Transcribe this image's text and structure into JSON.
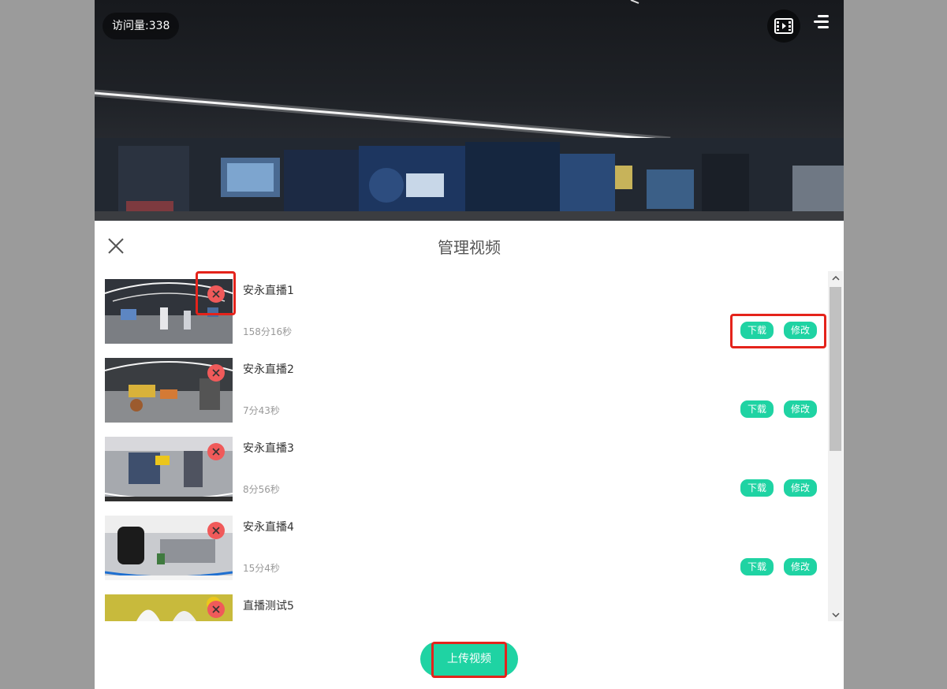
{
  "panorama": {
    "visit_count_text": "访问量:338",
    "icons": {
      "video": "film-icon",
      "menu": "menu-icon"
    }
  },
  "panel": {
    "title": "管理视频",
    "close_icon": "close-icon",
    "delete_icon": "delete-circle-icon",
    "items": [
      {
        "title": "安永直播1",
        "duration": "158分16秒",
        "download": "下载",
        "edit": "修改"
      },
      {
        "title": "安永直播2",
        "duration": "7分43秒",
        "download": "下载",
        "edit": "修改"
      },
      {
        "title": "安永直播3",
        "duration": "8分56秒",
        "download": "下载",
        "edit": "修改"
      },
      {
        "title": "安永直播4",
        "duration": "15分4秒",
        "download": "下载",
        "edit": "修改"
      },
      {
        "title": "直播测试5"
      }
    ],
    "upload_label": "上传视频"
  },
  "colors": {
    "accent": "#1fd3a3",
    "delete": "#f05a5a",
    "highlight": "#e4231b",
    "page_background": "#9b9b9b"
  }
}
